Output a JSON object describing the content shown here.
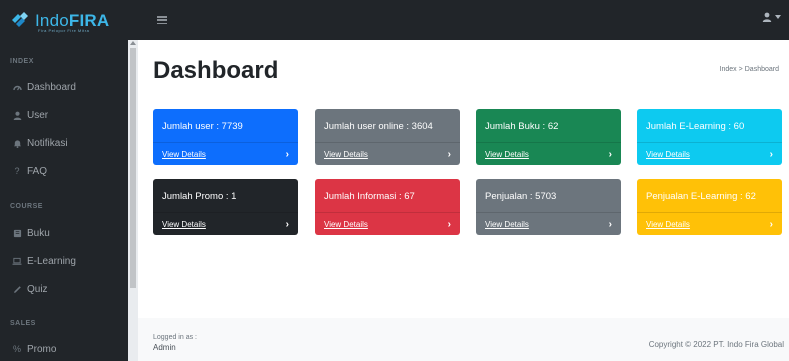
{
  "brand": {
    "name_light": "Indo",
    "name_bold": "FIRA",
    "tagline": "Fira Pelopor Fire Mitra"
  },
  "colors": {
    "accent": "#3db7e8",
    "sidebar_bg": "#212529",
    "primary": "#0d6efd",
    "secondary": "#6c757d",
    "success": "#198754",
    "info": "#0dcaf0",
    "dark": "#212529",
    "danger": "#dc3545",
    "warning": "#ffc107"
  },
  "topbar": {
    "toggle_icon": "hamburger-icon",
    "user_icon": "user-icon"
  },
  "sidebar": {
    "sections": [
      {
        "heading": "INDEX",
        "items": [
          {
            "label": "Dashboard",
            "icon": "dashboard-icon"
          },
          {
            "label": "User",
            "icon": "user-icon"
          },
          {
            "label": "Notifikasi",
            "icon": "bell-icon"
          },
          {
            "label": "FAQ",
            "icon": "question-icon"
          }
        ]
      },
      {
        "heading": "COURSE",
        "items": [
          {
            "label": "Buku",
            "icon": "book-icon"
          },
          {
            "label": "E-Learning",
            "icon": "laptop-icon"
          },
          {
            "label": "Quiz",
            "icon": "pencil-icon"
          }
        ]
      },
      {
        "heading": "SALES",
        "items": [
          {
            "label": "Promo",
            "icon": "percent-icon"
          }
        ]
      }
    ]
  },
  "main": {
    "title": "Dashboard",
    "breadcrumb": [
      "Index",
      "Dashboard"
    ],
    "breadcrumb_sep": ">",
    "cards": [
      {
        "title": "Jumlah user : 7739",
        "link": "View Details",
        "color": "primary"
      },
      {
        "title": "Jumlah user online : 3604",
        "link": "View Details",
        "color": "secondary"
      },
      {
        "title": "Jumlah Buku : 62",
        "link": "View Details",
        "color": "success"
      },
      {
        "title": "Jumlah E-Learning : 60",
        "link": "View Details",
        "color": "info"
      },
      {
        "title": "Jumlah Promo : 1",
        "link": "View Details",
        "color": "dark"
      },
      {
        "title": "Jumlah Informasi : 67",
        "link": "View Details",
        "color": "danger"
      },
      {
        "title": "Penjualan : 5703",
        "link": "View Details",
        "color": "secondary"
      },
      {
        "title": "Penjualan E-Learning : 62",
        "link": "View Details",
        "color": "warning"
      }
    ]
  },
  "footer": {
    "logged_label": "Logged in as :",
    "logged_user": "Admin",
    "copyright": "Copyright © 2022 PT. Indo Fira Global"
  }
}
